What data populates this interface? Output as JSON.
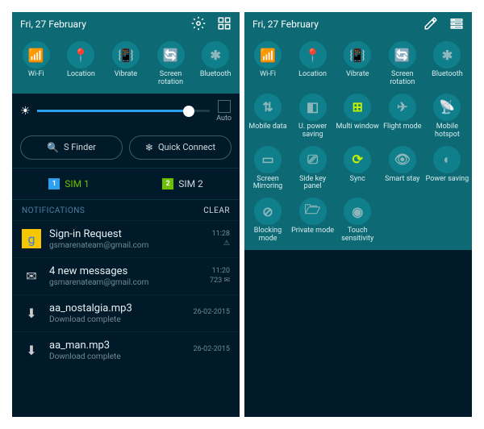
{
  "left": {
    "date": "Fri, 27 February",
    "toggles": [
      {
        "label": "Wi-Fi",
        "icon": "wifi",
        "active": true
      },
      {
        "label": "Location",
        "icon": "location",
        "active": false
      },
      {
        "label": "Vibrate",
        "icon": "vibrate",
        "active": true
      },
      {
        "label": "Screen rotation",
        "icon": "rotation",
        "active": true
      },
      {
        "label": "Bluetooth",
        "icon": "bluetooth",
        "active": false
      }
    ],
    "brightness": {
      "auto_label": "Auto",
      "percent": 88
    },
    "actions": {
      "sfinder": "S Finder",
      "quickconnect": "Quick Connect"
    },
    "sims": {
      "sim1": "SIM 1",
      "sim2": "SIM 2"
    },
    "notif_header": {
      "title": "NOTIFICATIONS",
      "clear": "CLEAR"
    },
    "notifications": [
      {
        "icon": "google",
        "title": "Sign-in Request",
        "sub": "gsmarenateam@gmail.com",
        "time": "11:28",
        "extra": "⚠"
      },
      {
        "icon": "mail",
        "title": "4 new messages",
        "sub": "gsmarenateam@gmail.com",
        "time": "11:20",
        "extra": "723 ✉"
      },
      {
        "icon": "download",
        "title": "aa_nostalgia.mp3",
        "sub": "Download complete",
        "time": "26-02-2015",
        "extra": ""
      },
      {
        "icon": "download",
        "title": "aa_man.mp3",
        "sub": "Download complete",
        "time": "26-02-2015",
        "extra": ""
      }
    ]
  },
  "right": {
    "date": "Fri, 27 February",
    "toggles": [
      {
        "label": "Wi-Fi",
        "icon": "wifi",
        "active": true
      },
      {
        "label": "Location",
        "icon": "location",
        "active": false
      },
      {
        "label": "Vibrate",
        "icon": "vibrate",
        "active": true
      },
      {
        "label": "Screen rotation",
        "icon": "rotation",
        "active": true
      },
      {
        "label": "Bluetooth",
        "icon": "bluetooth",
        "active": false
      },
      {
        "label": "Mobile data",
        "icon": "mobiledata",
        "active": false
      },
      {
        "label": "U. power saving",
        "icon": "upowersave",
        "active": false
      },
      {
        "label": "Multi window",
        "icon": "multiwindow",
        "active": true
      },
      {
        "label": "Flight mode",
        "icon": "flight",
        "active": false
      },
      {
        "label": "Mobile hotspot",
        "icon": "hotspot",
        "active": false
      },
      {
        "label": "Screen Mirroring",
        "icon": "mirror",
        "active": false
      },
      {
        "label": "Side key panel",
        "icon": "sidekey",
        "active": false
      },
      {
        "label": "Sync",
        "icon": "sync",
        "active": true
      },
      {
        "label": "Smart stay",
        "icon": "smartstay",
        "active": false
      },
      {
        "label": "Power saving",
        "icon": "powersave",
        "active": false
      },
      {
        "label": "Blocking mode",
        "icon": "blocking",
        "active": false
      },
      {
        "label": "Private mode",
        "icon": "private",
        "active": false
      },
      {
        "label": "Touch sensitivity",
        "icon": "touch",
        "active": false
      }
    ]
  },
  "icons": {
    "wifi": "📶",
    "location": "📍",
    "vibrate": "📳",
    "rotation": "🔄",
    "bluetooth": "✱",
    "mobiledata": "⇅",
    "upowersave": "◧",
    "multiwindow": "⊞",
    "flight": "✈",
    "hotspot": "📡",
    "mirror": "▭",
    "sidekey": "⎚",
    "sync": "⟳",
    "smartstay": "👁",
    "powersave": "◐",
    "blocking": "⊘",
    "private": "🗁",
    "touch": "◉",
    "google": "g",
    "mail": "✉",
    "download": "⬇"
  }
}
